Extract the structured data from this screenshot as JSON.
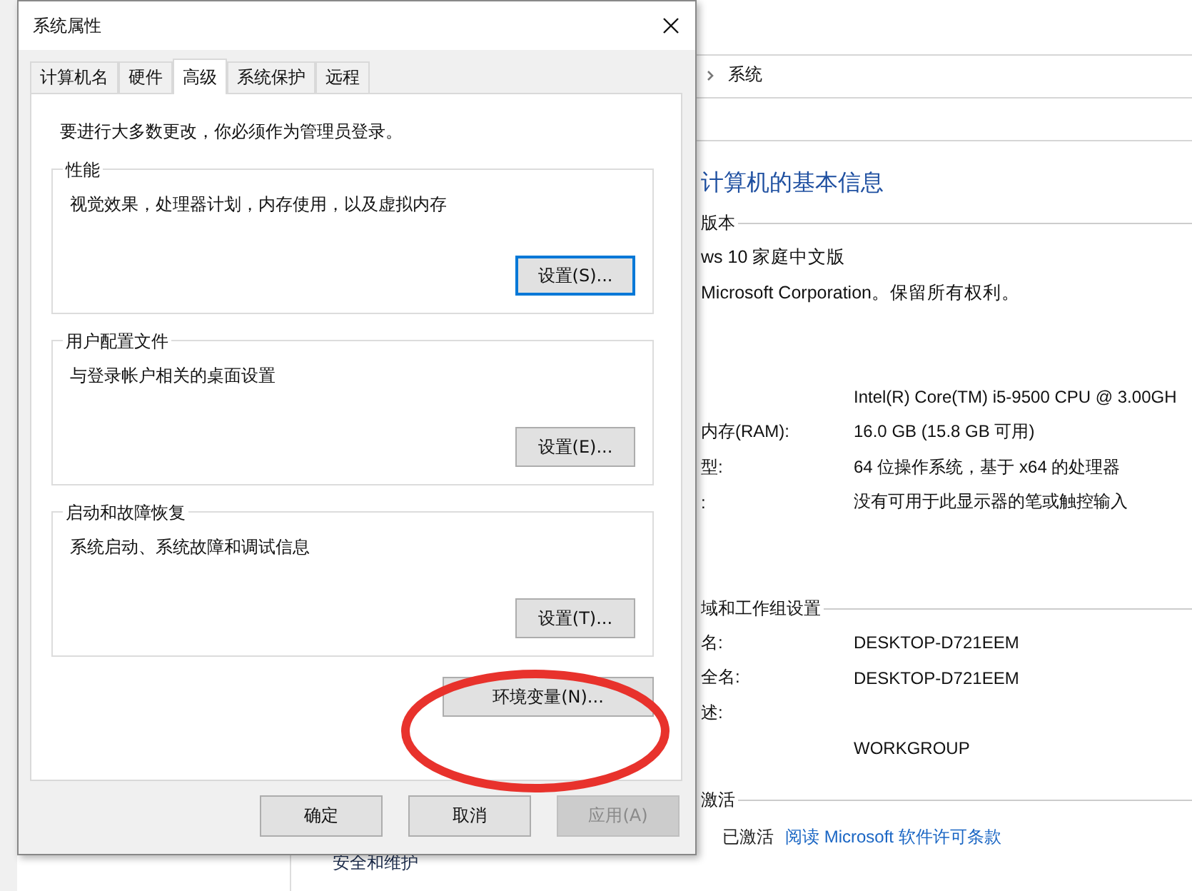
{
  "background_window": {
    "breadcrumb": "系统",
    "heading": "计算机的基本信息",
    "edition": {
      "title": "版本",
      "lines": [
        "ws 10 家庭中文版",
        "Microsoft Corporation。保留所有权利。"
      ]
    },
    "system": {
      "rows": [
        {
          "label": "",
          "value": "Intel(R) Core(TM) i5-9500 CPU @ 3.00GH"
        },
        {
          "label": "内存(RAM):",
          "value": "16.0 GB (15.8 GB 可用)"
        },
        {
          "label": "型:",
          "value": "64 位操作系统，基于 x64 的处理器"
        },
        {
          "label": ":",
          "value": "没有可用于此显示器的笔或触控输入"
        }
      ]
    },
    "domain": {
      "title": "域和工作组设置",
      "rows": [
        {
          "label": "名:",
          "value": "DESKTOP-D721EEM"
        },
        {
          "label": "全名:",
          "value": "DESKTOP-D721EEM"
        },
        {
          "label": "述:",
          "value": ""
        },
        {
          "label": "",
          "value": "WORKGROUP"
        }
      ]
    },
    "activation": {
      "title": "激活",
      "status": "已激活",
      "link": "阅读 Microsoft 软件许可条款"
    },
    "sidebar": {
      "items": [
        "安全和维护"
      ]
    }
  },
  "dialog": {
    "title": "系统属性",
    "tabs": [
      {
        "label": "计算机名",
        "selected": false
      },
      {
        "label": "硬件",
        "selected": false
      },
      {
        "label": "高级",
        "selected": true
      },
      {
        "label": "系统保护",
        "selected": false
      },
      {
        "label": "远程",
        "selected": false
      }
    ],
    "notice": "要进行大多数更改，你必须作为管理员登录。",
    "groups": [
      {
        "title": "性能",
        "description": "视觉效果，处理器计划，内存使用，以及虚拟内存",
        "button": "设置(S)...",
        "focused": true
      },
      {
        "title": "用户配置文件",
        "description": "与登录帐户相关的桌面设置",
        "button": "设置(E)...",
        "focused": false
      },
      {
        "title": "启动和故障恢复",
        "description": "系统启动、系统故障和调试信息",
        "button": "设置(T)...",
        "focused": false
      }
    ],
    "env_button": "环境变量(N)...",
    "buttons": [
      {
        "label": "确定",
        "disabled": false
      },
      {
        "label": "取消",
        "disabled": false
      },
      {
        "label": "应用(A)",
        "disabled": true
      }
    ]
  }
}
